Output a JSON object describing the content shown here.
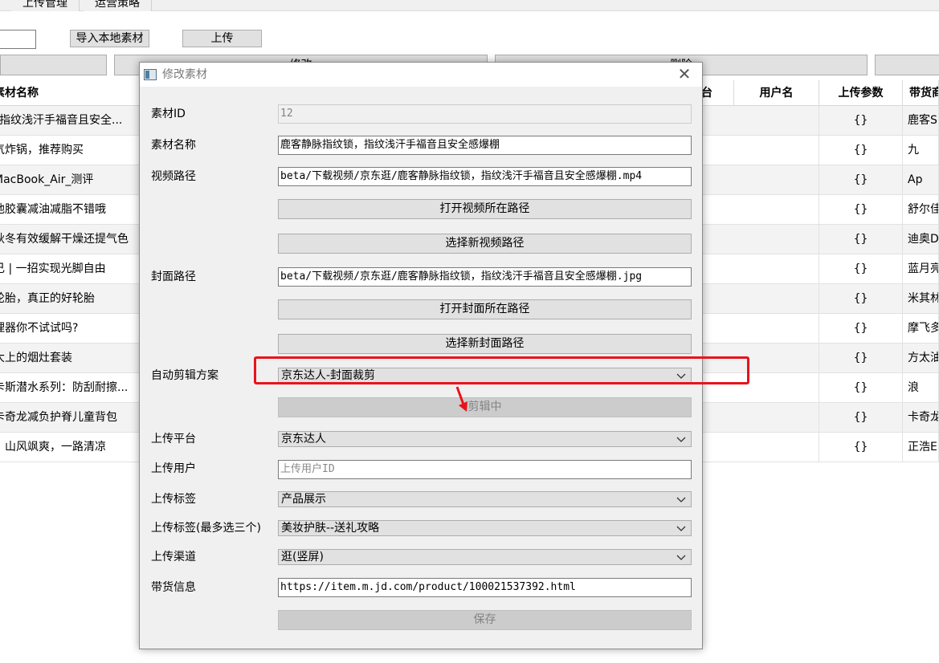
{
  "tabs": [
    "上传管理",
    "运营策略"
  ],
  "toolbar": {
    "import_label": "导入本地素材",
    "upload_label": "上传"
  },
  "action_buttons": {
    "edit_label": "修改",
    "delete_label": "删除"
  },
  "table": {
    "headers": {
      "name": "素材名称",
      "platform": "台",
      "user": "用户名",
      "params": "上传参数",
      "goods": "带货商"
    },
    "rows": [
      {
        "name": "_指纹浅汗手福音且安全...",
        "params": "{}",
        "goods": "鹿客S"
      },
      {
        "name": "气炸锅，推荐购买",
        "params": "{}",
        "goods": "九"
      },
      {
        "name": "MacBook_Air_测评",
        "params": "{}",
        "goods": "Ap"
      },
      {
        "name": "他胶囊减油减脂不错哦",
        "params": "{}",
        "goods": "舒尔佳"
      },
      {
        "name": "秋冬有效缓解干燥还提气色",
        "params": "{}",
        "goods": "迪奥D"
      },
      {
        "name": "己 | 一招实现光脚自由",
        "params": "{}",
        "goods": "蓝月亮"
      },
      {
        "name": "轮胎，真正的好轮胎",
        "params": "{}",
        "goods": "米其林"
      },
      {
        "name": "理器你不试试吗?",
        "params": "{}",
        "goods": "摩飞多"
      },
      {
        "name": "大上的烟灶套装",
        "params": "{}",
        "goods": "方太油"
      },
      {
        "name": "卡斯潜水系列：防刮耐擦...",
        "params": "{}",
        "goods": "浪"
      },
      {
        "name": "卡奇龙减负护脊儿童背包",
        "params": "{}",
        "goods": "卡奇龙"
      },
      {
        "name": "，山风飒爽，一路清凉",
        "params": "{}",
        "goods": "正浩E"
      }
    ]
  },
  "dialog": {
    "title": "修改素材",
    "labels": {
      "id": "素材ID",
      "name": "素材名称",
      "video_path": "视频路径",
      "cover_path": "封面路径",
      "auto_edit": "自动剪辑方案",
      "platform": "上传平台",
      "user": "上传用户",
      "tag": "上传标签",
      "tags_multi": "上传标签(最多选三个)",
      "channel": "上传渠道",
      "goods_info": "带货信息"
    },
    "values": {
      "id": "12",
      "name": "鹿客静脉指纹锁，指纹浅汗手福音且安全感爆棚",
      "video_path": "beta/下载视频/京东逛/鹿客静脉指纹锁，指纹浅汗手福音且安全感爆棚.mp4",
      "cover_path": "beta/下载视频/京东逛/鹿客静脉指纹锁，指纹浅汗手福音且安全感爆棚.jpg",
      "auto_edit": "京东达人-封面裁剪",
      "platform": "京东达人",
      "user_placeholder": "上传用户ID",
      "tag": "产品展示",
      "tags_multi": "美妆护肤--送礼攻略",
      "channel": "逛(竖屏)",
      "goods_info": "https://item.m.jd.com/product/100021537392.html"
    },
    "buttons": {
      "open_video_dir": "打开视频所在路径",
      "choose_video": "选择新视频路径",
      "open_cover_dir": "打开封面所在路径",
      "choose_cover": "选择新封面路径",
      "editing": "剪辑中",
      "save": "保存"
    }
  },
  "annotation_color": "#e8141b"
}
